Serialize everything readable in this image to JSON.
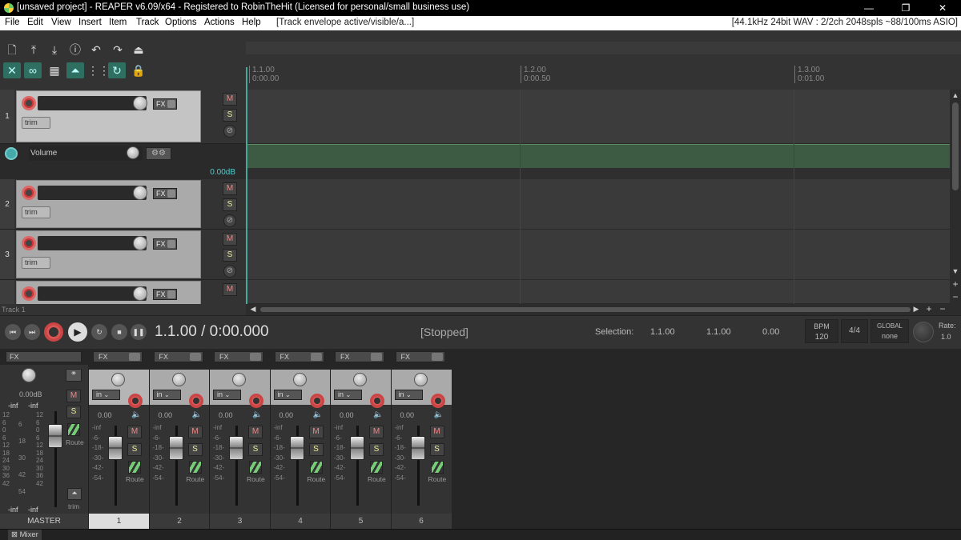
{
  "window": {
    "title": "[unsaved project] - REAPER v6.09/x64 - Registered to RobinTheHit (Licensed for personal/small business use)",
    "min": "—",
    "max": "❐",
    "close": "✕"
  },
  "menu": {
    "items": [
      "File",
      "Edit",
      "View",
      "Insert",
      "Item",
      "Track",
      "Options",
      "Actions",
      "Help"
    ],
    "envelope_status": "[Track envelope active/visible/a...]",
    "audio_status": "[44.1kHz 24bit WAV : 2/2ch 2048spls ~88/100ms ASIO]"
  },
  "ruler": {
    "markers": [
      {
        "bar": "1.1.00",
        "time": "0:00.00"
      },
      {
        "bar": "1.2.00",
        "time": "0:00.50"
      },
      {
        "bar": "1.3.00",
        "time": "0:01.00"
      }
    ]
  },
  "tracks": [
    {
      "num": "1",
      "trim": "trim"
    },
    {
      "num": "2",
      "trim": "trim"
    },
    {
      "num": "3",
      "trim": "trim"
    },
    {
      "num": "",
      "trim": ""
    }
  ],
  "envelope": {
    "name": "Volume",
    "value": "0.00dB"
  },
  "track_label": "Track 1",
  "transport": {
    "position": "1.1.00 / 0:00.000",
    "status": "[Stopped]",
    "selection_label": "Selection:",
    "sel_start": "1.1.00",
    "sel_end": "1.1.00",
    "sel_len": "0.00",
    "bpm_label": "BPM",
    "bpm": "120",
    "timesig": "4/4",
    "global_label": "GLOBAL",
    "global_val": "none",
    "rate_label": "Rate:",
    "rate": "1.0"
  },
  "mixer": {
    "master": {
      "fx": "FX",
      "db": "0.00dB",
      "peak_l": "-inf",
      "peak_r": "-inf",
      "bot_l": "-inf",
      "bot_r": "-inf",
      "m": "M",
      "s": "S",
      "route": "Route",
      "trim": "trim",
      "label": "MASTER",
      "scale_l": [
        "12",
        "6",
        "0",
        "6",
        "12",
        "18",
        "24",
        "30",
        "36",
        "42"
      ],
      "scale_c": [
        "6",
        "18",
        "30",
        "42",
        "54"
      ],
      "scale_r": [
        "12",
        "6",
        "0",
        "6",
        "12",
        "18",
        "24",
        "30",
        "36",
        "42"
      ]
    },
    "fx": "FX",
    "in": "in",
    "db": "0.00",
    "m": "M",
    "s": "S",
    "route": "Route",
    "scale": [
      "-inf",
      "-6-",
      "-18-",
      "-30-",
      "-42-",
      "-54-"
    ],
    "strips": [
      "1",
      "2",
      "3",
      "4",
      "5",
      "6"
    ],
    "tab": "Mixer"
  }
}
